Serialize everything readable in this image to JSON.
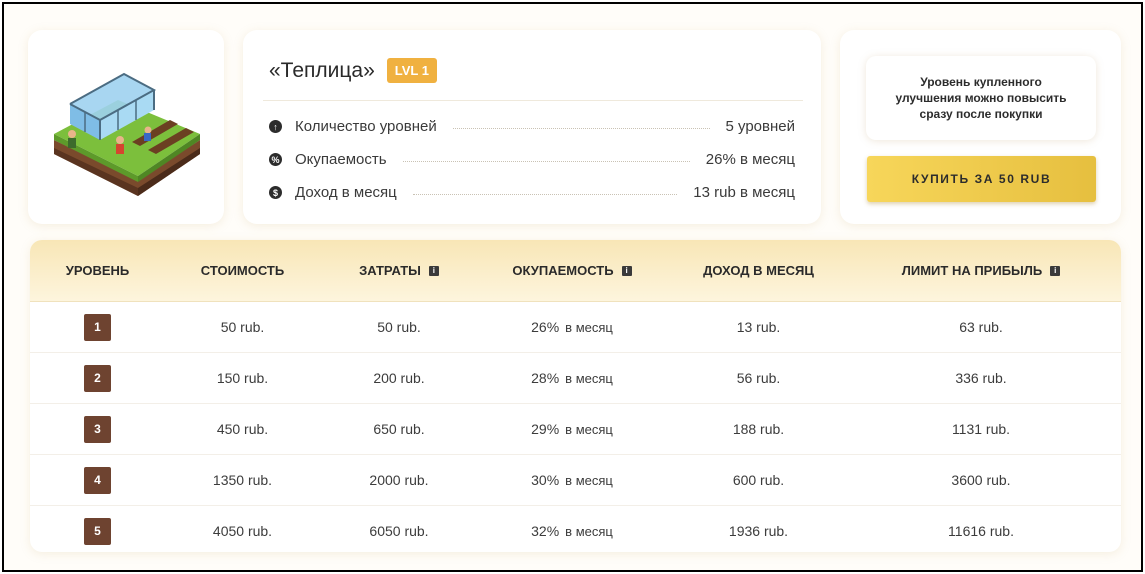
{
  "card": {
    "title": "«Теплица»",
    "level_badge": "LVL 1",
    "image_icon": "greenhouse-illustration"
  },
  "stats": [
    {
      "label": "Количество уровней",
      "value": "5 уровней",
      "icon": "arrow-up-icon"
    },
    {
      "label": "Окупаемость",
      "value": "26% в месяц",
      "icon": "percent-icon"
    },
    {
      "label": "Доход в месяц",
      "value": "13 rub в месяц",
      "icon": "dollar-icon"
    }
  ],
  "buy": {
    "note": "Уровень купленного улучшения можно повысить сразу после покупки",
    "button_label": "КУПИТЬ ЗА 50 RUB"
  },
  "table": {
    "headers": [
      "УРОВЕНЬ",
      "СТОИМОСТЬ",
      "ЗАТРАТЫ",
      "ОКУПАЕМОСТЬ",
      "ДОХОД В МЕСЯЦ",
      "ЛИМИТ НА ПРИБЫЛЬ"
    ],
    "per_month": "в месяц",
    "rows": [
      {
        "level": "1",
        "cost": "50 rub.",
        "expenses": "50 rub.",
        "payback": "26%",
        "income": "13 rub.",
        "limit": "63 rub."
      },
      {
        "level": "2",
        "cost": "150 rub.",
        "expenses": "200 rub.",
        "payback": "28%",
        "income": "56 rub.",
        "limit": "336 rub."
      },
      {
        "level": "3",
        "cost": "450 rub.",
        "expenses": "650 rub.",
        "payback": "29%",
        "income": "188 rub.",
        "limit": "1131 rub."
      },
      {
        "level": "4",
        "cost": "1350 rub.",
        "expenses": "2000 rub.",
        "payback": "30%",
        "income": "600 rub.",
        "limit": "3600 rub."
      },
      {
        "level": "5",
        "cost": "4050 rub.",
        "expenses": "6050 rub.",
        "payback": "32%",
        "income": "1936 rub.",
        "limit": "11616 rub."
      }
    ]
  },
  "colors": {
    "accent": "#f0b140",
    "button": "#f2cf4f",
    "badge": "#6e4330",
    "header": "#f8e6b6"
  }
}
